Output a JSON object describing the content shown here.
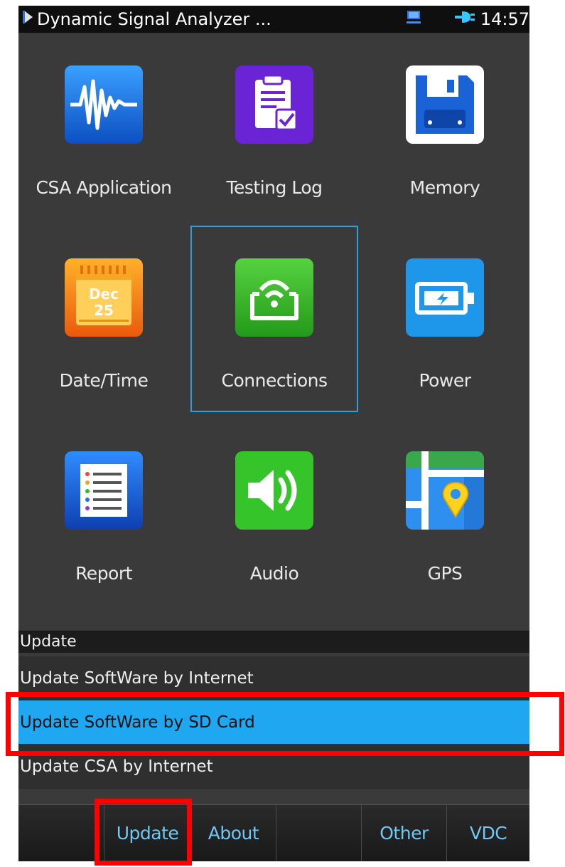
{
  "status": {
    "title": "Dynamic Signal Analyzer ...",
    "time": "14:57",
    "icons": [
      "play-triangle-icon",
      "network-icon",
      "plug-icon"
    ]
  },
  "apps": [
    {
      "label": "CSA Application",
      "icon": "waveform-icon",
      "color": "#1f78e8"
    },
    {
      "label": "Testing Log",
      "icon": "clipboard-check-icon",
      "color": "#6a24d6"
    },
    {
      "label": "Memory",
      "icon": "floppy-disk-icon",
      "color": "#ffffff"
    },
    {
      "label": "Date/Time",
      "icon": "calendar-icon",
      "color": "#f07a12",
      "month": "Dec",
      "day": "25"
    },
    {
      "label": "Connections",
      "icon": "wifi-tablet-icon",
      "color": "#3bb62a",
      "selected": true
    },
    {
      "label": "Power",
      "icon": "battery-icon",
      "color": "#1e97ea"
    },
    {
      "label": "Report",
      "icon": "report-list-icon",
      "color": "#1a5fd0"
    },
    {
      "label": "Audio",
      "icon": "speaker-icon",
      "color": "#35c52a"
    },
    {
      "label": "GPS",
      "icon": "map-pin-icon",
      "color": "#2e8ff0"
    }
  ],
  "menu": {
    "header": "Update",
    "items": [
      {
        "label": "Update SoftWare by Internet",
        "active": false
      },
      {
        "label": "Update SoftWare by SD Card",
        "active": true
      },
      {
        "label": "Update CSA by Internet",
        "active": false
      }
    ]
  },
  "tabs": [
    {
      "label": ""
    },
    {
      "label": "Update"
    },
    {
      "label": "About"
    },
    {
      "label": ""
    },
    {
      "label": "Other"
    },
    {
      "label": "VDC"
    }
  ],
  "colors": {
    "selection": "#1fa7f2",
    "highlight_annotation": "#ff0000",
    "tab_text": "#6ec8f5"
  }
}
